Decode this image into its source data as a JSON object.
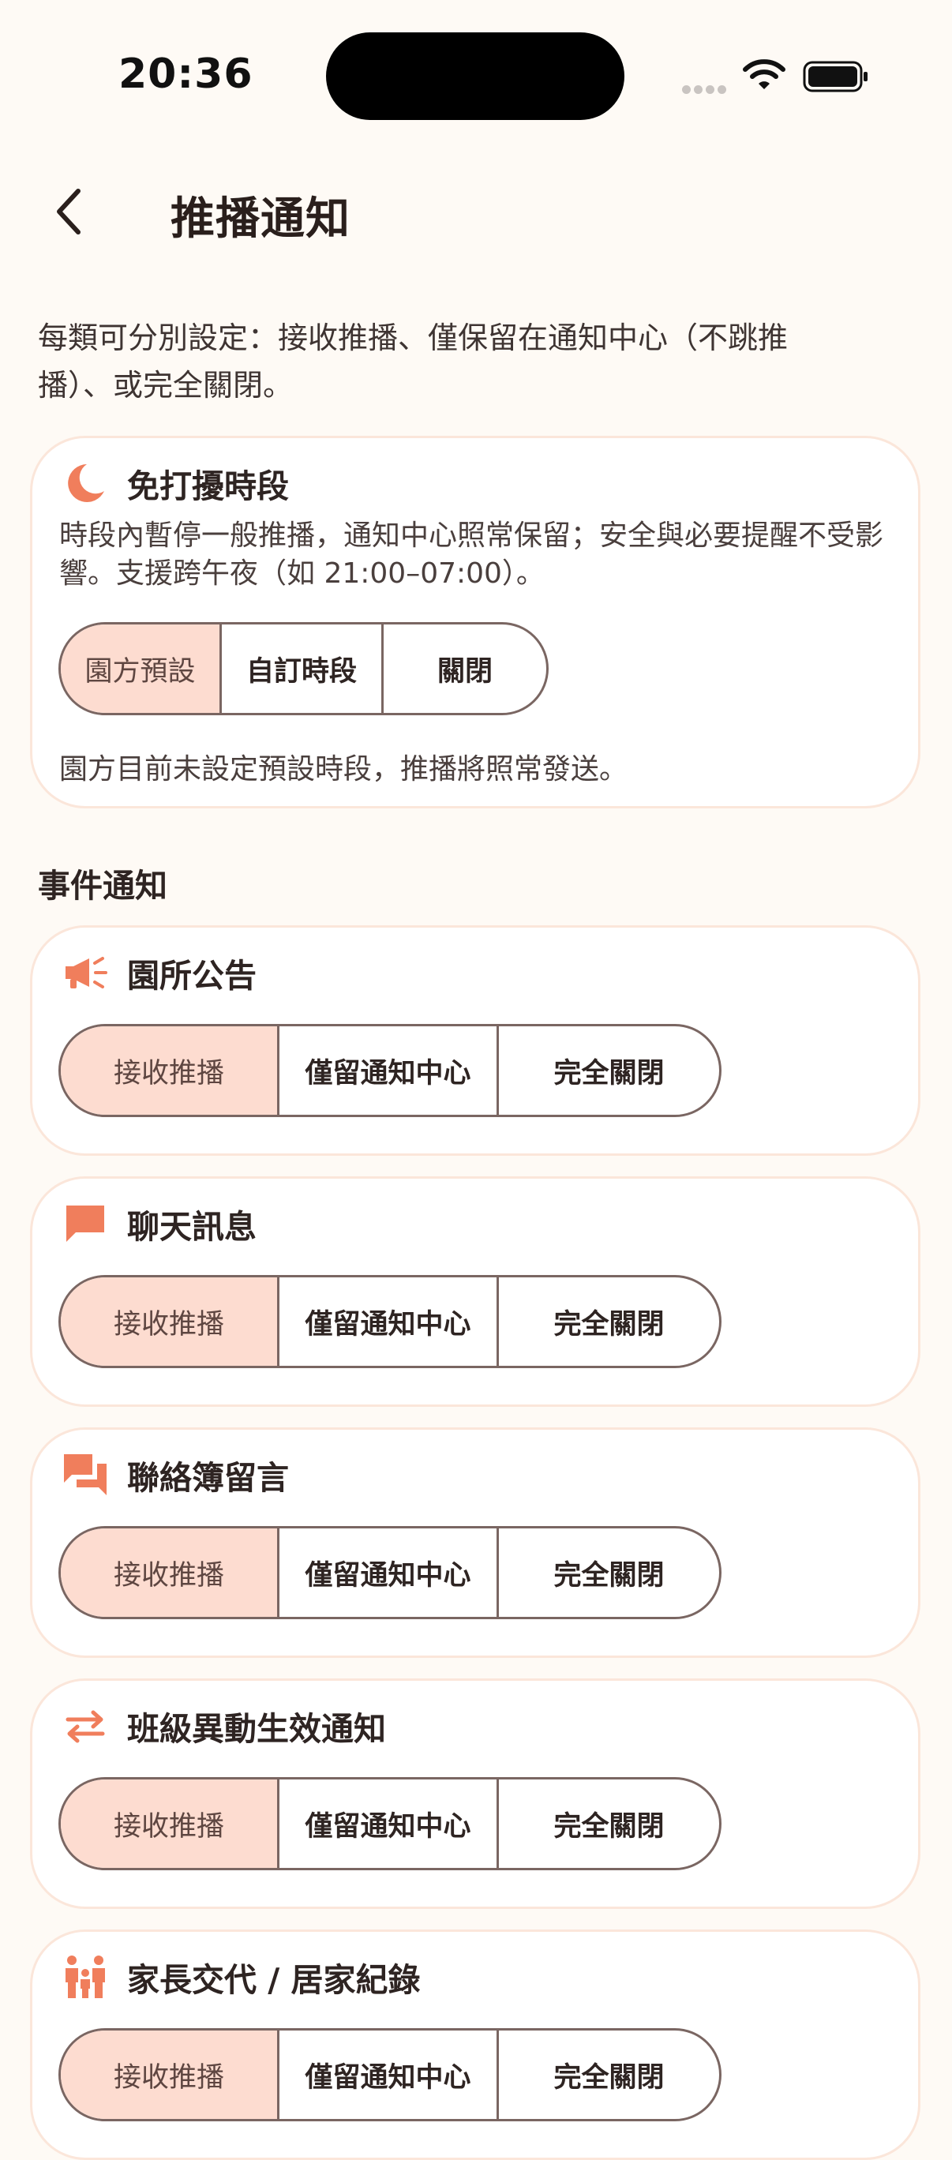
{
  "status_bar": {
    "time": "20:36"
  },
  "header": {
    "title": "推播通知"
  },
  "intro_text": "每類可分別設定：接收推播、僅保留在通知中心（不跳推播）、或完全關閉。",
  "quiet_hours": {
    "title": "免打擾時段",
    "description": "時段內暫停一般推播，通知中心照常保留；安全與必要提醒不受影響。支援跨午夜（如 21:00–07:00）。",
    "options": [
      "園方預設",
      "自訂時段",
      "關閉"
    ],
    "selected": "園方預設",
    "note": "園方目前未設定預設時段，推播將照常發送。"
  },
  "events_section": {
    "title": "事件通知",
    "options": [
      "接收推播",
      "僅留通知中心",
      "完全關閉"
    ],
    "items": [
      {
        "title": "園所公告",
        "icon": "megaphone-icon",
        "selected": "接收推播"
      },
      {
        "title": "聊天訊息",
        "icon": "chat-bubble-icon",
        "selected": "接收推播"
      },
      {
        "title": "聯絡簿留言",
        "icon": "comments-icon",
        "selected": "接收推播"
      },
      {
        "title": "班級異動生效通知",
        "icon": "swap-arrows-icon",
        "selected": "接收推播"
      },
      {
        "title": "家長交代 / 居家紀錄",
        "icon": "family-icon",
        "selected": "接收推播"
      }
    ]
  },
  "colors": {
    "accent": "#F07E5C",
    "selected_bg": "#FDDCD0",
    "background": "#FEFAF5",
    "border": "#7A6662"
  }
}
